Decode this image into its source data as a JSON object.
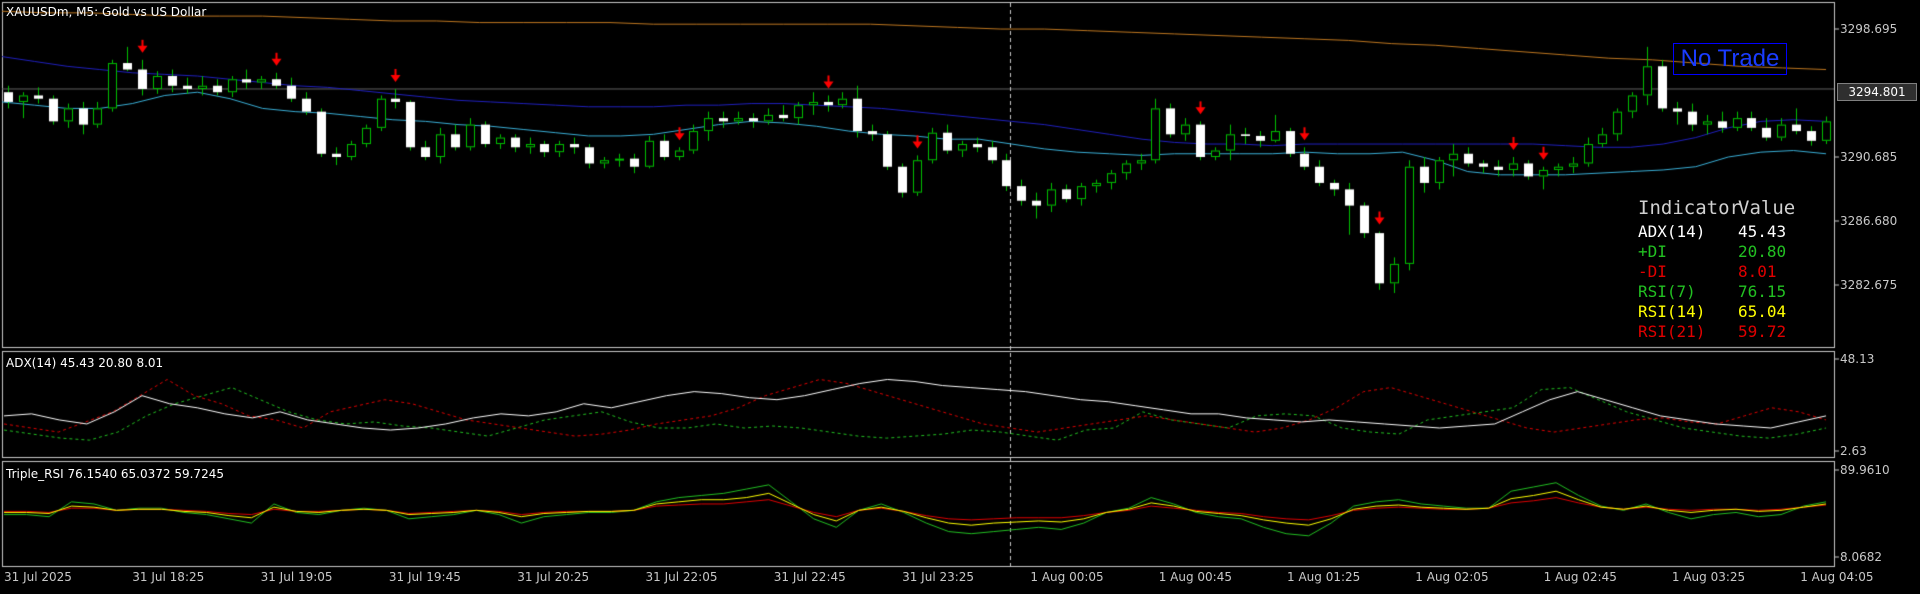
{
  "main_panel": {
    "title": "XAUUSDm, M5:  Gold vs US Dollar",
    "price_levels": [
      "3298.695",
      "3290.685",
      "3286.680",
      "3282.675"
    ],
    "current_price": "3294.801",
    "signal": "No Trade"
  },
  "indicator_table": {
    "headers": [
      "Indicator",
      "Value"
    ],
    "rows": [
      {
        "name": "ADX(14)",
        "value": "45.43",
        "color": "#ffffff"
      },
      {
        "name": "+DI",
        "value": "20.80",
        "color": "#22c022"
      },
      {
        "name": "-DI",
        "value": "8.01",
        "color": "#e00000"
      },
      {
        "name": "RSI(7)",
        "value": "76.15",
        "color": "#22c022"
      },
      {
        "name": "RSI(14)",
        "value": "65.04",
        "color": "#ffff00"
      },
      {
        "name": "RSI(21)",
        "value": "59.72",
        "color": "#e00000"
      }
    ]
  },
  "adx_panel": {
    "title": "ADX(14) 45.43 20.80 8.01",
    "levels": [
      "48.13",
      "2.63"
    ]
  },
  "rsi_panel": {
    "title": "Triple_RSI 76.1540 65.0372 59.7245",
    "levels": [
      "89.9610",
      "8.0682"
    ]
  },
  "time_axis": [
    "31 Jul 2025",
    "31 Jul 18:25",
    "31 Jul 19:05",
    "31 Jul 19:45",
    "31 Jul 20:25",
    "31 Jul 22:05",
    "31 Jul 22:45",
    "31 Jul 23:25",
    "1 Aug 00:05",
    "1 Aug 00:45",
    "1 Aug 01:25",
    "1 Aug 02:05",
    "1 Aug 02:45",
    "1 Aug 03:25",
    "1 Aug 04:05"
  ],
  "colors": {
    "background": "#000000",
    "bull_candle": "#ffffff",
    "bear_candle": "#ffffff",
    "wick": "#00c000",
    "ma_fast": "#3ab0d8",
    "ma_mid": "#2020c0",
    "ma_slow": "#c07820",
    "sell_arrow": "#ff0000",
    "adx_line": "#ffffff",
    "plus_di": "#22c022",
    "minus_di": "#e00000",
    "rsi7": "#22c022",
    "rsi14": "#ffff00",
    "rsi21": "#e00000"
  },
  "chart_data": {
    "type": "candlestick",
    "candles_ohlc": [
      [
        3294.6,
        3295.0,
        3293.6,
        3294.0
      ],
      [
        3294.0,
        3294.6,
        3293.0,
        3294.4
      ],
      [
        3294.4,
        3294.9,
        3293.9,
        3294.2
      ],
      [
        3294.2,
        3294.4,
        3292.6,
        3292.8
      ],
      [
        3292.8,
        3293.9,
        3292.4,
        3293.6
      ],
      [
        3293.6,
        3294.0,
        3292.0,
        3292.6
      ],
      [
        3292.6,
        3294.0,
        3292.4,
        3293.6
      ],
      [
        3293.6,
        3296.6,
        3293.4,
        3296.4
      ],
      [
        3296.4,
        3297.4,
        3295.9,
        3296.0
      ],
      [
        3296.0,
        3296.6,
        3294.4,
        3294.8
      ],
      [
        3294.8,
        3295.9,
        3294.5,
        3295.6
      ],
      [
        3295.6,
        3296.0,
        3294.6,
        3295.0
      ],
      [
        3295.0,
        3295.5,
        3294.5,
        3294.8
      ],
      [
        3294.8,
        3295.6,
        3294.4,
        3295.0
      ],
      [
        3295.0,
        3295.4,
        3294.4,
        3294.6
      ],
      [
        3294.6,
        3295.6,
        3294.3,
        3295.4
      ],
      [
        3295.4,
        3296.0,
        3294.8,
        3295.2
      ],
      [
        3295.2,
        3295.6,
        3294.8,
        3295.4
      ],
      [
        3295.4,
        3295.8,
        3294.8,
        3295.0
      ],
      [
        3295.0,
        3295.5,
        3294.0,
        3294.2
      ],
      [
        3294.2,
        3294.6,
        3293.2,
        3293.4
      ],
      [
        3293.4,
        3293.6,
        3290.6,
        3290.8
      ],
      [
        3290.8,
        3291.2,
        3290.1,
        3290.6
      ],
      [
        3290.6,
        3291.6,
        3290.4,
        3291.4
      ],
      [
        3291.4,
        3292.6,
        3291.2,
        3292.4
      ],
      [
        3292.4,
        3294.4,
        3292.2,
        3294.2
      ],
      [
        3294.2,
        3294.8,
        3293.6,
        3294.0
      ],
      [
        3294.0,
        3294.1,
        3291.0,
        3291.2
      ],
      [
        3291.2,
        3291.6,
        3290.4,
        3290.6
      ],
      [
        3290.6,
        3292.4,
        3290.2,
        3292.0
      ],
      [
        3292.0,
        3292.6,
        3291.0,
        3291.2
      ],
      [
        3291.2,
        3293.0,
        3291.0,
        3292.6
      ],
      [
        3292.6,
        3292.8,
        3291.2,
        3291.4
      ],
      [
        3291.4,
        3292.0,
        3291.1,
        3291.8
      ],
      [
        3291.8,
        3292.0,
        3290.9,
        3291.2
      ],
      [
        3291.2,
        3291.8,
        3290.8,
        3291.4
      ],
      [
        3291.4,
        3291.6,
        3290.6,
        3290.9
      ],
      [
        3290.9,
        3291.6,
        3290.6,
        3291.4
      ],
      [
        3291.4,
        3291.8,
        3290.8,
        3291.2
      ],
      [
        3291.2,
        3291.4,
        3289.9,
        3290.2
      ],
      [
        3290.2,
        3290.6,
        3289.9,
        3290.4
      ],
      [
        3290.4,
        3290.8,
        3290.0,
        3290.5
      ],
      [
        3290.5,
        3290.8,
        3289.6,
        3290.0
      ],
      [
        3290.0,
        3291.9,
        3289.9,
        3291.6
      ],
      [
        3291.6,
        3292.0,
        3290.4,
        3290.6
      ],
      [
        3290.6,
        3291.2,
        3290.4,
        3291.0
      ],
      [
        3291.0,
        3292.6,
        3290.8,
        3292.2
      ],
      [
        3292.2,
        3293.4,
        3291.6,
        3293.0
      ],
      [
        3293.0,
        3293.4,
        3292.4,
        3292.8
      ],
      [
        3292.8,
        3293.4,
        3292.6,
        3293.0
      ],
      [
        3293.0,
        3293.3,
        3292.4,
        3292.8
      ],
      [
        3292.8,
        3293.6,
        3292.6,
        3293.2
      ],
      [
        3293.2,
        3293.8,
        3292.8,
        3293.0
      ],
      [
        3293.0,
        3294.0,
        3292.6,
        3293.8
      ],
      [
        3293.8,
        3294.6,
        3293.2,
        3294.0
      ],
      [
        3294.0,
        3294.4,
        3293.4,
        3293.8
      ],
      [
        3293.8,
        3294.6,
        3293.6,
        3294.2
      ],
      [
        3294.2,
        3295.0,
        3291.8,
        3292.2
      ],
      [
        3292.2,
        3292.6,
        3291.6,
        3292.0
      ],
      [
        3292.0,
        3292.2,
        3289.8,
        3290.0
      ],
      [
        3290.0,
        3290.2,
        3288.1,
        3288.4
      ],
      [
        3288.4,
        3290.7,
        3288.2,
        3290.4
      ],
      [
        3290.4,
        3292.4,
        3290.2,
        3292.1
      ],
      [
        3292.1,
        3292.6,
        3290.8,
        3291.0
      ],
      [
        3291.0,
        3291.6,
        3290.6,
        3291.4
      ],
      [
        3291.4,
        3291.8,
        3290.9,
        3291.2
      ],
      [
        3291.2,
        3291.6,
        3290.2,
        3290.4
      ],
      [
        3290.4,
        3290.8,
        3288.5,
        3288.8
      ],
      [
        3288.8,
        3289.2,
        3287.6,
        3287.9
      ],
      [
        3287.9,
        3288.4,
        3286.8,
        3287.6
      ],
      [
        3287.6,
        3289.0,
        3287.2,
        3288.6
      ],
      [
        3288.6,
        3288.9,
        3287.8,
        3288.0
      ],
      [
        3288.0,
        3289.0,
        3287.6,
        3288.8
      ],
      [
        3288.8,
        3289.2,
        3288.4,
        3289.0
      ],
      [
        3289.0,
        3289.8,
        3288.6,
        3289.6
      ],
      [
        3289.6,
        3290.4,
        3289.2,
        3290.2
      ],
      [
        3290.2,
        3290.8,
        3289.8,
        3290.4
      ],
      [
        3290.4,
        3294.2,
        3290.2,
        3293.6
      ],
      [
        3293.6,
        3293.9,
        3291.8,
        3292.0
      ],
      [
        3292.0,
        3293.0,
        3291.6,
        3292.6
      ],
      [
        3292.6,
        3292.8,
        3290.4,
        3290.6
      ],
      [
        3290.6,
        3291.2,
        3290.4,
        3291.0
      ],
      [
        3291.0,
        3292.6,
        3290.4,
        3292.0
      ],
      [
        3292.0,
        3292.4,
        3291.4,
        3291.9
      ],
      [
        3291.9,
        3292.2,
        3291.2,
        3291.6
      ],
      [
        3291.6,
        3293.2,
        3291.5,
        3292.2
      ],
      [
        3292.2,
        3292.4,
        3290.6,
        3290.8
      ],
      [
        3290.8,
        3291.2,
        3289.8,
        3290.0
      ],
      [
        3290.0,
        3290.4,
        3288.8,
        3289.0
      ],
      [
        3289.0,
        3289.2,
        3288.2,
        3288.6
      ],
      [
        3288.6,
        3289.0,
        3285.8,
        3287.6
      ],
      [
        3287.6,
        3287.8,
        3285.6,
        3285.9
      ],
      [
        3285.9,
        3286.0,
        3282.4,
        3282.8
      ],
      [
        3282.8,
        3284.4,
        3282.2,
        3284.0
      ],
      [
        3284.0,
        3290.4,
        3283.6,
        3290.0
      ],
      [
        3290.0,
        3290.6,
        3288.4,
        3289.0
      ],
      [
        3289.0,
        3290.6,
        3288.6,
        3290.4
      ],
      [
        3290.4,
        3291.4,
        3289.4,
        3290.8
      ],
      [
        3290.8,
        3291.2,
        3290.0,
        3290.2
      ],
      [
        3290.2,
        3290.4,
        3289.6,
        3290.0
      ],
      [
        3290.0,
        3290.4,
        3289.4,
        3289.8
      ],
      [
        3289.8,
        3290.6,
        3289.4,
        3290.2
      ],
      [
        3290.2,
        3290.4,
        3289.2,
        3289.4
      ],
      [
        3289.4,
        3290.0,
        3288.6,
        3289.8
      ],
      [
        3289.8,
        3290.2,
        3289.4,
        3290.0
      ],
      [
        3290.0,
        3290.6,
        3289.6,
        3290.2
      ],
      [
        3290.2,
        3291.8,
        3290.0,
        3291.4
      ],
      [
        3291.4,
        3292.4,
        3291.2,
        3292.0
      ],
      [
        3292.0,
        3293.6,
        3291.6,
        3293.4
      ],
      [
        3293.4,
        3294.6,
        3293.0,
        3294.4
      ],
      [
        3294.4,
        3297.4,
        3293.8,
        3296.2
      ],
      [
        3296.2,
        3296.6,
        3293.4,
        3293.6
      ],
      [
        3293.6,
        3294.0,
        3292.6,
        3293.4
      ],
      [
        3293.4,
        3293.9,
        3292.2,
        3292.6
      ],
      [
        3292.6,
        3293.2,
        3292.0,
        3292.8
      ],
      [
        3292.8,
        3293.4,
        3292.1,
        3292.4
      ],
      [
        3292.4,
        3293.4,
        3292.2,
        3293.0
      ],
      [
        3293.0,
        3293.4,
        3292.2,
        3292.4
      ],
      [
        3292.4,
        3293.0,
        3291.6,
        3291.8
      ],
      [
        3291.8,
        3293.0,
        3291.6,
        3292.6
      ],
      [
        3292.6,
        3293.6,
        3292.0,
        3292.2
      ],
      [
        3292.2,
        3292.5,
        3291.3,
        3291.6
      ],
      [
        3291.6,
        3293.1,
        3291.4,
        3292.8
      ]
    ],
    "ma_fast": [
      3294.0,
      3293.8,
      3293.6,
      3293.6,
      3293.9,
      3294.4,
      3294.6,
      3294.2,
      3293.6,
      3293.4,
      3293.3,
      3293.1,
      3292.9,
      3292.8,
      3292.6,
      3292.5,
      3292.3,
      3292.1,
      3291.9,
      3291.9,
      3292.0,
      3292.3,
      3292.6,
      3292.8,
      3292.7,
      3292.5,
      3292.2,
      3292.0,
      3291.9,
      3291.7,
      3291.7,
      3291.4,
      3291.1,
      3290.9,
      3290.8,
      3290.7,
      3290.8,
      3290.8,
      3290.8,
      3290.8,
      3290.9,
      3290.8,
      3290.8,
      3290.9,
      3290.4,
      3289.7,
      3289.5,
      3289.5,
      3289.5,
      3289.6,
      3289.7,
      3289.8,
      3290.0,
      3290.6,
      3290.9,
      3291.0,
      3290.8
    ],
    "ma_mid": [
      3296.8,
      3296.5,
      3296.2,
      3296.0,
      3295.8,
      3295.7,
      3295.6,
      3295.4,
      3295.2,
      3295.0,
      3294.9,
      3294.7,
      3294.5,
      3294.3,
      3294.1,
      3294.0,
      3293.9,
      3293.8,
      3293.7,
      3293.7,
      3293.7,
      3293.8,
      3293.8,
      3293.9,
      3293.9,
      3293.8,
      3293.7,
      3293.6,
      3293.4,
      3293.2,
      3293.0,
      3292.8,
      3292.6,
      3292.3,
      3292.0,
      3291.7,
      3291.5,
      3291.4,
      3291.4,
      3291.3,
      3291.4,
      3291.4,
      3291.4,
      3291.4,
      3291.4,
      3291.4,
      3291.4,
      3291.4,
      3291.3,
      3291.2,
      3291.2,
      3291.4,
      3291.8,
      3292.4,
      3292.8,
      3292.9,
      3292.8
    ],
    "ma_slow": [
      3299.6,
      3299.5,
      3299.5,
      3299.4,
      3299.3,
      3299.3,
      3299.3,
      3299.2,
      3299.1,
      3299.0,
      3299.0,
      3298.9,
      3298.9,
      3298.9,
      3298.9,
      3298.8,
      3298.8,
      3298.8,
      3298.8,
      3298.8,
      3298.8,
      3298.7,
      3298.6,
      3298.5,
      3298.5,
      3298.4,
      3298.3,
      3298.2,
      3298.1,
      3298.0,
      3297.9,
      3297.8,
      3297.6,
      3297.5,
      3297.3,
      3297.1,
      3296.9,
      3296.7,
      3296.6,
      3296.4,
      3296.2,
      3296.1,
      3296.0
    ],
    "adx": [
      20,
      21,
      18,
      16,
      22,
      30,
      26,
      24,
      21,
      19,
      22,
      18,
      16,
      14,
      13,
      14,
      16,
      19,
      21,
      20,
      22,
      26,
      24,
      27,
      30,
      32,
      31,
      29,
      28,
      30,
      33,
      36,
      38,
      37,
      35,
      34,
      33,
      32,
      30,
      28,
      27,
      25,
      23,
      21,
      21,
      19,
      18,
      17,
      18,
      17,
      16,
      15,
      14,
      15,
      16,
      22,
      28,
      32,
      28,
      24,
      20,
      18,
      16,
      15,
      14,
      17,
      20
    ],
    "plus_di": [
      13,
      11,
      9,
      8,
      12,
      20,
      26,
      30,
      34,
      28,
      22,
      18,
      16,
      17,
      15,
      14,
      12,
      10,
      14,
      18,
      20,
      22,
      17,
      14,
      14,
      16,
      14,
      15,
      14,
      12,
      10,
      9,
      10,
      11,
      13,
      12,
      10,
      8,
      13,
      14,
      22,
      18,
      16,
      14,
      20,
      21,
      20,
      14,
      12,
      11,
      18,
      20,
      22,
      24,
      33,
      34,
      28,
      22,
      18,
      14,
      12,
      10,
      9,
      11,
      14
    ],
    "minus_di": [
      16,
      14,
      12,
      17,
      22,
      30,
      38,
      30,
      26,
      20,
      18,
      14,
      22,
      25,
      28,
      26,
      22,
      18,
      16,
      14,
      12,
      10,
      11,
      13,
      16,
      18,
      20,
      24,
      30,
      34,
      38,
      36,
      32,
      28,
      24,
      20,
      16,
      14,
      12,
      14,
      16,
      18,
      20,
      18,
      16,
      14,
      12,
      14,
      18,
      24,
      32,
      34,
      30,
      26,
      22,
      18,
      14,
      12,
      14,
      16,
      18,
      19,
      17,
      16,
      20,
      24,
      22,
      18
    ],
    "rsi7": [
      48,
      48,
      46,
      60,
      58,
      52,
      54,
      54,
      50,
      48,
      44,
      40,
      58,
      50,
      48,
      52,
      54,
      52,
      44,
      46,
      48,
      52,
      48,
      40,
      46,
      48,
      50,
      50,
      52,
      60,
      64,
      66,
      68,
      72,
      76,
      60,
      44,
      36,
      52,
      58,
      50,
      40,
      32,
      30,
      32,
      34,
      36,
      34,
      40,
      50,
      54,
      64,
      58,
      50,
      46,
      44,
      36,
      30,
      28,
      40,
      56,
      60,
      62,
      58,
      56,
      54,
      54,
      70,
      74,
      78,
      66,
      56,
      52,
      58,
      50,
      44,
      48,
      50,
      46,
      48,
      56,
      60
    ],
    "rsi14": [
      50,
      50,
      49,
      56,
      55,
      52,
      53,
      53,
      51,
      50,
      47,
      45,
      55,
      51,
      50,
      52,
      53,
      52,
      48,
      49,
      50,
      52,
      50,
      46,
      49,
      50,
      51,
      51,
      52,
      58,
      60,
      62,
      62,
      64,
      68,
      58,
      48,
      42,
      52,
      55,
      51,
      45,
      40,
      38,
      40,
      41,
      42,
      41,
      44,
      50,
      53,
      59,
      56,
      51,
      49,
      47,
      43,
      40,
      38,
      44,
      53,
      56,
      57,
      55,
      54,
      53,
      54,
      63,
      66,
      70,
      62,
      55,
      53,
      56,
      52,
      50,
      52,
      53,
      51,
      52,
      55,
      58
    ],
    "rsi21": [
      51,
      51,
      50,
      54,
      54,
      52,
      53,
      53,
      52,
      51,
      49,
      48,
      53,
      51,
      51,
      52,
      53,
      52,
      49,
      50,
      51,
      52,
      51,
      48,
      50,
      51,
      51,
      51,
      52,
      56,
      57,
      58,
      58,
      60,
      62,
      56,
      50,
      46,
      52,
      54,
      51,
      47,
      44,
      43,
      44,
      45,
      45,
      45,
      47,
      50,
      52,
      56,
      54,
      52,
      50,
      49,
      46,
      44,
      43,
      47,
      52,
      54,
      55,
      54,
      53,
      53,
      54,
      59,
      61,
      64,
      59,
      55,
      53,
      55,
      53,
      52,
      53,
      53,
      52,
      53,
      55,
      57
    ],
    "sell_arrow_candles": [
      9,
      18,
      26,
      45,
      55,
      61,
      80,
      87,
      92,
      101,
      103
    ]
  }
}
